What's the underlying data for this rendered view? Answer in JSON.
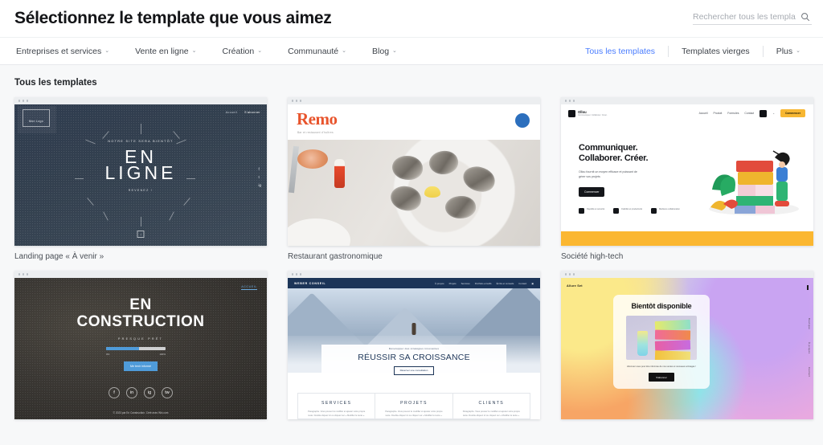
{
  "header": {
    "title": "Sélectionnez le template que vous aimez",
    "search_placeholder": "Rechercher tous les templates...",
    "search_value": "",
    "search_icon": "search-icon"
  },
  "nav": {
    "left_items": [
      {
        "label": "Entreprises et services",
        "caret": "⌄"
      },
      {
        "label": "Vente en ligne",
        "caret": "⌄"
      },
      {
        "label": "Création",
        "caret": "⌄"
      },
      {
        "label": "Communauté",
        "caret": "⌄"
      },
      {
        "label": "Blog",
        "caret": "⌄"
      }
    ],
    "right_items": [
      {
        "label": "Tous les templates",
        "caret": ""
      },
      {
        "label": "Templates vierges",
        "caret": ""
      },
      {
        "label": "Plus",
        "caret": "⌄"
      }
    ],
    "active_color": "#4a7dff"
  },
  "section": {
    "title": "Tous les templates"
  },
  "cards": [
    {
      "label": "Landing page « À venir »",
      "preview": {
        "logo": "Mon Logo",
        "nav": [
          "Accueil",
          "S'abonner"
        ],
        "kicker": "NOTRE SITE SERA BIENTÔT",
        "headline_line1": "EN",
        "headline_line2": "LIGNE",
        "subline": "REVENEZ !",
        "socials": [
          "f",
          "t",
          "ig"
        ],
        "scroll_hint": "↓"
      }
    },
    {
      "label": "Restaurant gastronomique",
      "preview": {
        "brand": "Remo",
        "tagline": "Bar et restaurant d'huîtres",
        "brand_color": "#e8542c",
        "badge_color": "#2c6fbd"
      }
    },
    {
      "label": "Société high-tech",
      "preview": {
        "logo_name": "Ollou",
        "logo_sub": "Communiquer. Collaborer. Créer.",
        "nav": [
          "Accueil",
          "Produit",
          "Formules",
          "Contact"
        ],
        "cta": "Commencer",
        "headline_line1": "Communiquer.",
        "headline_line2": "Collaborer. Créer.",
        "body": "Ollou fournit un moyen efficace et puissant de gérer vos projets",
        "button": "Commencer",
        "features": [
          "Rapidité et sécurité",
          "Fiabilité et productivité",
          "Meilleure collaboration"
        ],
        "accent_color": "#fbb731"
      }
    },
    {
      "label": "",
      "preview": {
        "home_link": "ACCUEIL",
        "headline_line1": "EN",
        "headline_line2": "CONSTRUCTION",
        "kicker": "PRESQUE PRÊT",
        "progress_min": "0%",
        "progress_max": "100%",
        "progress_value": 56,
        "button": "Me tenir informé",
        "socials": [
          "f",
          "in",
          "ig",
          "tw"
        ],
        "footer": "© 2023 par En Construction. Créé avec Wix.com",
        "accent_color": "#4f9bd9"
      }
    },
    {
      "label": "",
      "preview": {
        "brand": "WEBER CONSEIL",
        "nav": [
          "À propos",
          "Projets",
          "Services",
          "Portfolio et tarifs",
          "Écrits et conseils",
          "Contact"
        ],
        "kicker": "Développer des stratégies innovantes",
        "headline": "RÉUSSIR SA CROISSANCE",
        "button": "Réserver une consultation",
        "columns": [
          {
            "title": "SERVICES",
            "body": "Paragraphe. Vous pouvez le modifier et ajouter votre propre texte. Double-cliquez ici ou cliquez sur « Modifier le texte »."
          },
          {
            "title": "PROJETS",
            "body": "Paragraphe. Vous pouvez le modifier et ajouter votre propre texte. Double-cliquez ici ou cliquez sur « Modifier le texte »."
          },
          {
            "title": "CLIENTS",
            "body": "Paragraphe. Vous pouvez le modifier et ajouter votre propre texte. Double-cliquez ici ou cliquez sur « Modifier le texte »."
          }
        ],
        "bar_color": "#1c3558"
      }
    },
    {
      "label": "",
      "preview": {
        "brand": "Allure Set",
        "title": "Bientôt disponible",
        "body": "Abonnez-vous pour être informée de nos ventes et nouveaux arrivages !",
        "button": "S'abonner",
        "side_links": [
          "Boutique",
          "À propos",
          "Contact"
        ]
      }
    }
  ]
}
